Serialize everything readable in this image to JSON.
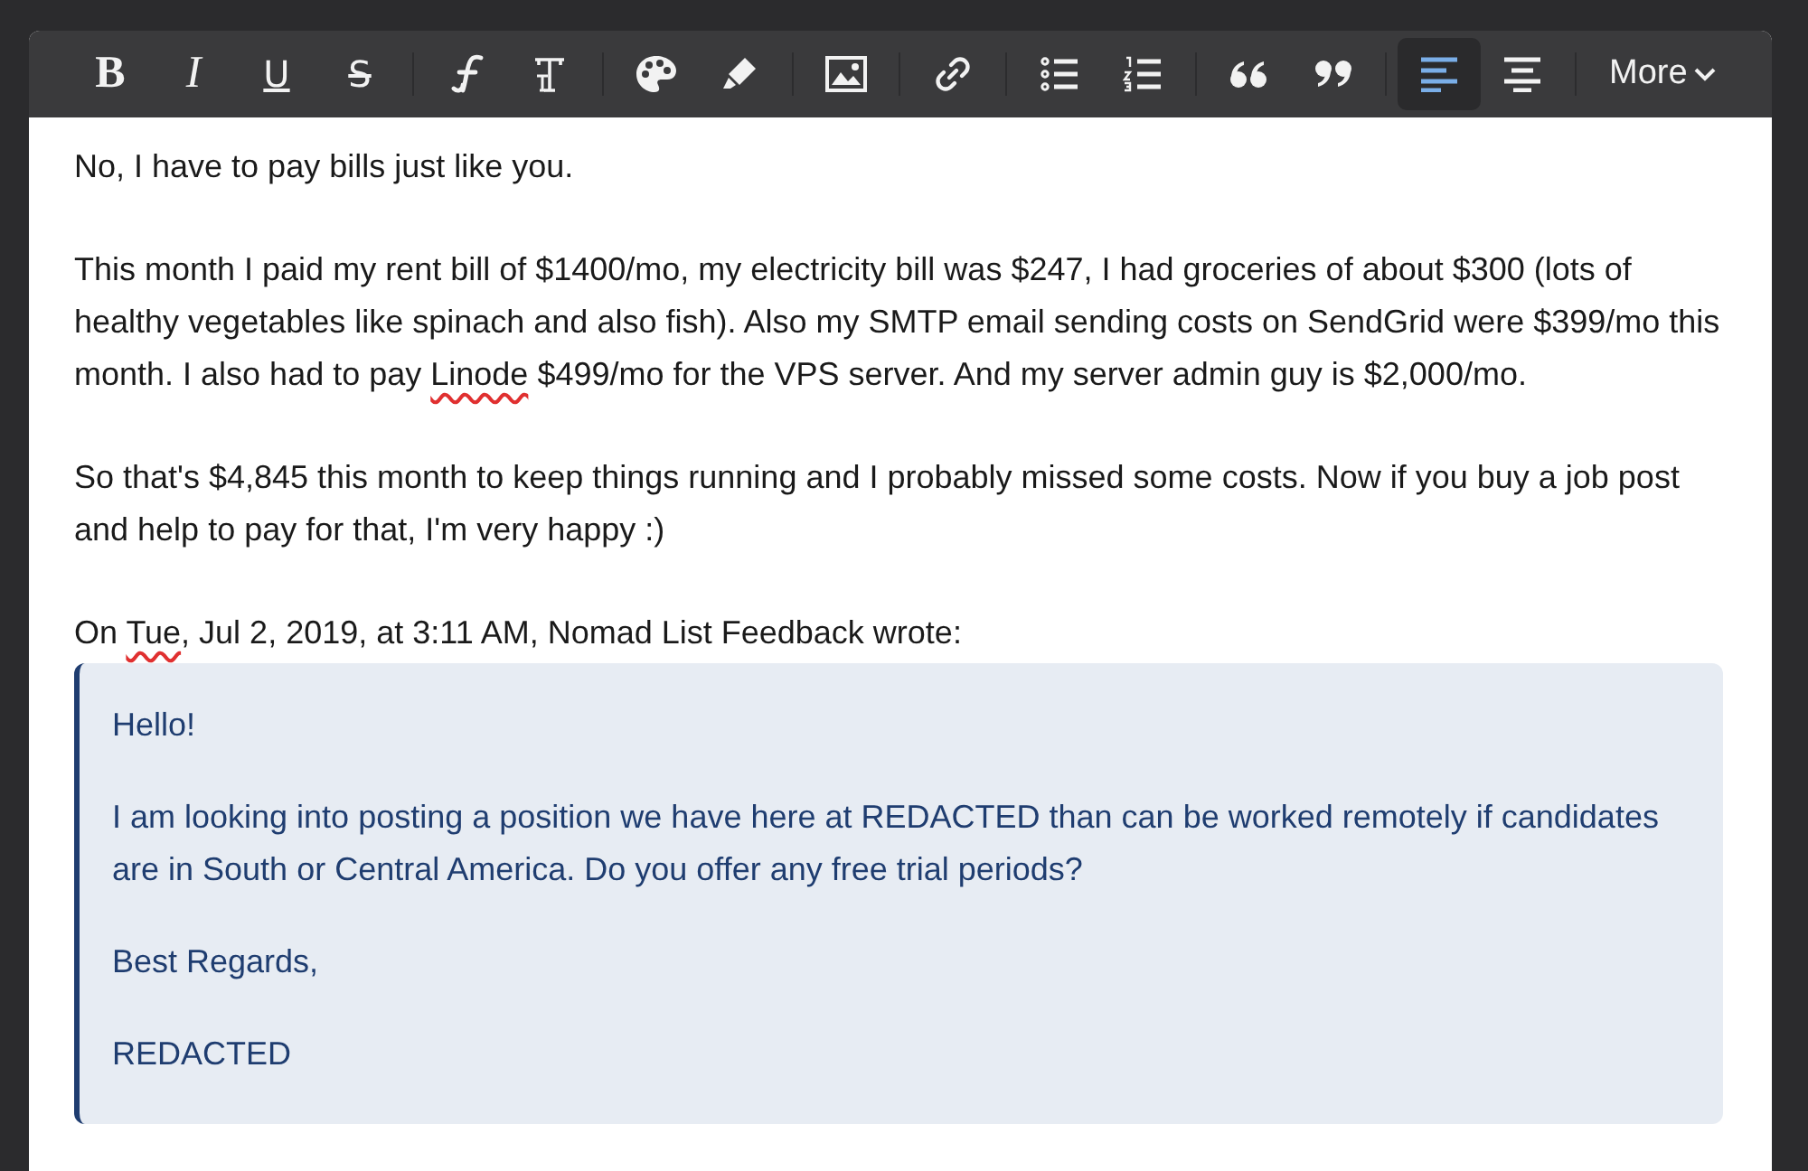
{
  "toolbar": {
    "groups": [
      [
        {
          "kind": "bold",
          "label": "B",
          "selected": false
        },
        {
          "kind": "italic",
          "label": "I",
          "selected": false
        },
        {
          "kind": "underline",
          "label": "U",
          "selected": false
        },
        {
          "kind": "strike",
          "label": "S",
          "selected": false
        }
      ],
      [
        {
          "kind": "font",
          "selected": false
        },
        {
          "kind": "size",
          "selected": false
        }
      ],
      [
        {
          "kind": "palette",
          "selected": false
        },
        {
          "kind": "highlighter",
          "selected": false
        }
      ],
      [
        {
          "kind": "image",
          "selected": false
        }
      ],
      [
        {
          "kind": "link",
          "selected": false
        }
      ],
      [
        {
          "kind": "bullets",
          "selected": false
        },
        {
          "kind": "numbers",
          "selected": false
        }
      ],
      [
        {
          "kind": "quote_open",
          "selected": false
        },
        {
          "kind": "quote_close",
          "selected": false
        }
      ],
      [
        {
          "kind": "align_left",
          "selected": true
        },
        {
          "kind": "align_center",
          "selected": false
        }
      ],
      [
        {
          "kind": "more",
          "label": "More",
          "selected": false
        }
      ]
    ]
  },
  "message": {
    "paragraphs": [
      [
        {
          "text": "No, I have to pay bills just like you.",
          "misspelled": false
        }
      ],
      [
        {
          "text": "This month I paid my rent bill of $1400/mo, my electricity bill was $247, I had groceries of about $300 (lots of healthy vegetables like spinach and also fish). Also my SMTP email sending costs on SendGrid were $399/mo this month. I also had to pay ",
          "misspelled": false
        },
        {
          "text": "Linode",
          "misspelled": true
        },
        {
          "text": " $499/mo for the VPS server. And my server admin guy is $2,000/mo.",
          "misspelled": false
        }
      ],
      [
        {
          "text": "So that's $4,845 this month to keep things running and I probably missed some costs. Now if you buy a job post and help to pay for that, I'm very happy :)",
          "misspelled": false
        }
      ],
      [
        {
          "text": "On ",
          "misspelled": false
        },
        {
          "text": "Tue",
          "misspelled": true
        },
        {
          "text": ", Jul 2, 2019, at 3:11 AM, Nomad List Feedback wrote:",
          "misspelled": false
        }
      ]
    ],
    "quote": [
      "Hello!",
      "I am looking into posting a position we have here at REDACTED than can be worked remotely if candidates are in South or Central America. Do you offer any free trial periods?",
      "Best Regards,",
      "REDACTED"
    ]
  }
}
